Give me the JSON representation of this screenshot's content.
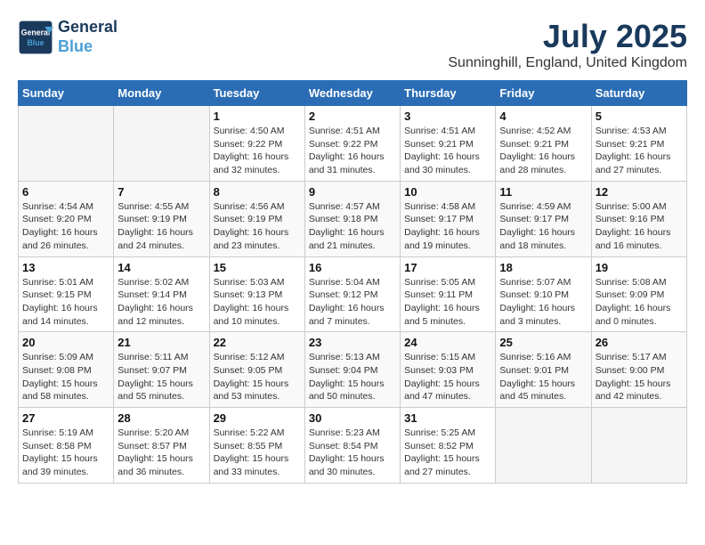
{
  "header": {
    "logo_line1": "General",
    "logo_line2": "Blue",
    "month_title": "July 2025",
    "location": "Sunninghill, England, United Kingdom"
  },
  "weekdays": [
    "Sunday",
    "Monday",
    "Tuesday",
    "Wednesday",
    "Thursday",
    "Friday",
    "Saturday"
  ],
  "weeks": [
    [
      {
        "day": "",
        "info": ""
      },
      {
        "day": "",
        "info": ""
      },
      {
        "day": "1",
        "info": "Sunrise: 4:50 AM\nSunset: 9:22 PM\nDaylight: 16 hours\nand 32 minutes."
      },
      {
        "day": "2",
        "info": "Sunrise: 4:51 AM\nSunset: 9:22 PM\nDaylight: 16 hours\nand 31 minutes."
      },
      {
        "day": "3",
        "info": "Sunrise: 4:51 AM\nSunset: 9:21 PM\nDaylight: 16 hours\nand 30 minutes."
      },
      {
        "day": "4",
        "info": "Sunrise: 4:52 AM\nSunset: 9:21 PM\nDaylight: 16 hours\nand 28 minutes."
      },
      {
        "day": "5",
        "info": "Sunrise: 4:53 AM\nSunset: 9:21 PM\nDaylight: 16 hours\nand 27 minutes."
      }
    ],
    [
      {
        "day": "6",
        "info": "Sunrise: 4:54 AM\nSunset: 9:20 PM\nDaylight: 16 hours\nand 26 minutes."
      },
      {
        "day": "7",
        "info": "Sunrise: 4:55 AM\nSunset: 9:19 PM\nDaylight: 16 hours\nand 24 minutes."
      },
      {
        "day": "8",
        "info": "Sunrise: 4:56 AM\nSunset: 9:19 PM\nDaylight: 16 hours\nand 23 minutes."
      },
      {
        "day": "9",
        "info": "Sunrise: 4:57 AM\nSunset: 9:18 PM\nDaylight: 16 hours\nand 21 minutes."
      },
      {
        "day": "10",
        "info": "Sunrise: 4:58 AM\nSunset: 9:17 PM\nDaylight: 16 hours\nand 19 minutes."
      },
      {
        "day": "11",
        "info": "Sunrise: 4:59 AM\nSunset: 9:17 PM\nDaylight: 16 hours\nand 18 minutes."
      },
      {
        "day": "12",
        "info": "Sunrise: 5:00 AM\nSunset: 9:16 PM\nDaylight: 16 hours\nand 16 minutes."
      }
    ],
    [
      {
        "day": "13",
        "info": "Sunrise: 5:01 AM\nSunset: 9:15 PM\nDaylight: 16 hours\nand 14 minutes."
      },
      {
        "day": "14",
        "info": "Sunrise: 5:02 AM\nSunset: 9:14 PM\nDaylight: 16 hours\nand 12 minutes."
      },
      {
        "day": "15",
        "info": "Sunrise: 5:03 AM\nSunset: 9:13 PM\nDaylight: 16 hours\nand 10 minutes."
      },
      {
        "day": "16",
        "info": "Sunrise: 5:04 AM\nSunset: 9:12 PM\nDaylight: 16 hours\nand 7 minutes."
      },
      {
        "day": "17",
        "info": "Sunrise: 5:05 AM\nSunset: 9:11 PM\nDaylight: 16 hours\nand 5 minutes."
      },
      {
        "day": "18",
        "info": "Sunrise: 5:07 AM\nSunset: 9:10 PM\nDaylight: 16 hours\nand 3 minutes."
      },
      {
        "day": "19",
        "info": "Sunrise: 5:08 AM\nSunset: 9:09 PM\nDaylight: 16 hours\nand 0 minutes."
      }
    ],
    [
      {
        "day": "20",
        "info": "Sunrise: 5:09 AM\nSunset: 9:08 PM\nDaylight: 15 hours\nand 58 minutes."
      },
      {
        "day": "21",
        "info": "Sunrise: 5:11 AM\nSunset: 9:07 PM\nDaylight: 15 hours\nand 55 minutes."
      },
      {
        "day": "22",
        "info": "Sunrise: 5:12 AM\nSunset: 9:05 PM\nDaylight: 15 hours\nand 53 minutes."
      },
      {
        "day": "23",
        "info": "Sunrise: 5:13 AM\nSunset: 9:04 PM\nDaylight: 15 hours\nand 50 minutes."
      },
      {
        "day": "24",
        "info": "Sunrise: 5:15 AM\nSunset: 9:03 PM\nDaylight: 15 hours\nand 47 minutes."
      },
      {
        "day": "25",
        "info": "Sunrise: 5:16 AM\nSunset: 9:01 PM\nDaylight: 15 hours\nand 45 minutes."
      },
      {
        "day": "26",
        "info": "Sunrise: 5:17 AM\nSunset: 9:00 PM\nDaylight: 15 hours\nand 42 minutes."
      }
    ],
    [
      {
        "day": "27",
        "info": "Sunrise: 5:19 AM\nSunset: 8:58 PM\nDaylight: 15 hours\nand 39 minutes."
      },
      {
        "day": "28",
        "info": "Sunrise: 5:20 AM\nSunset: 8:57 PM\nDaylight: 15 hours\nand 36 minutes."
      },
      {
        "day": "29",
        "info": "Sunrise: 5:22 AM\nSunset: 8:55 PM\nDaylight: 15 hours\nand 33 minutes."
      },
      {
        "day": "30",
        "info": "Sunrise: 5:23 AM\nSunset: 8:54 PM\nDaylight: 15 hours\nand 30 minutes."
      },
      {
        "day": "31",
        "info": "Sunrise: 5:25 AM\nSunset: 8:52 PM\nDaylight: 15 hours\nand 27 minutes."
      },
      {
        "day": "",
        "info": ""
      },
      {
        "day": "",
        "info": ""
      }
    ]
  ]
}
